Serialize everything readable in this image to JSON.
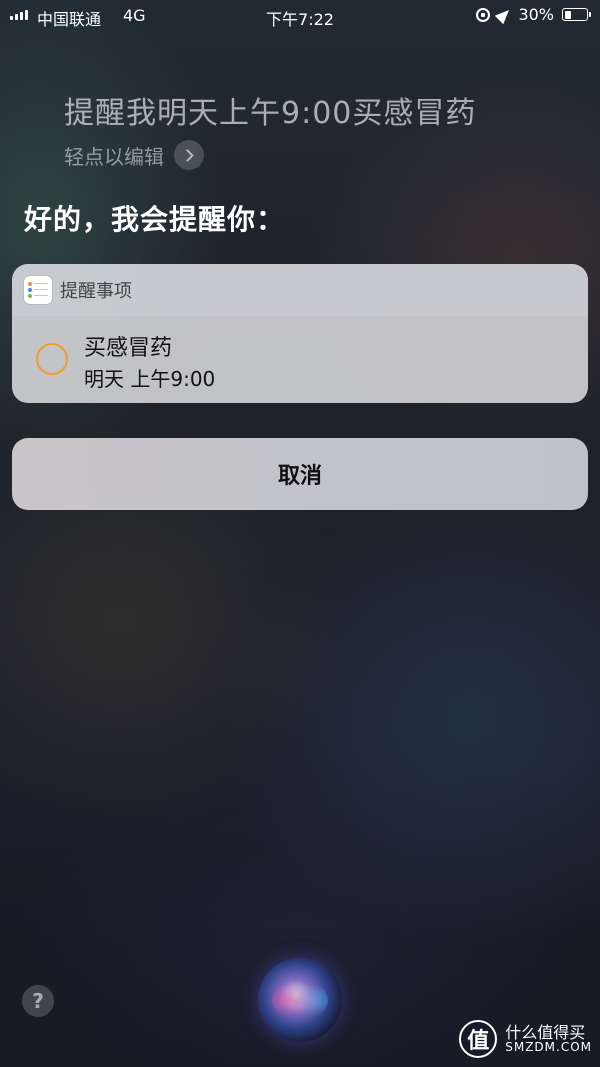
{
  "status_bar": {
    "carrier": "中国联通",
    "network": "4G",
    "time": "下午7:22",
    "battery_percent": "30%",
    "battery_level": 0.3
  },
  "siri": {
    "query": "提醒我明天上午9:00买感冒药",
    "tap_to_edit": "轻点以编辑",
    "reply": "好的，我会提醒你："
  },
  "reminder_card": {
    "app_name": "提醒事项",
    "item_title": "买感冒药",
    "item_time": "明天 上午9:00",
    "accent_color": "#f39b2d"
  },
  "cancel_label": "取消",
  "help_label": "?",
  "watermark": {
    "logo": "值",
    "name": "什么值得买",
    "domain": "SMZDM.COM"
  }
}
